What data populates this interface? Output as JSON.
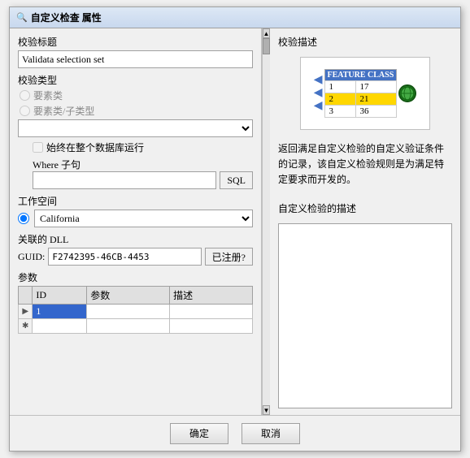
{
  "dialog": {
    "title": "自定义检查 属性"
  },
  "left": {
    "section_validation_title": "校验标题",
    "validation_title_value": "Validata selection set",
    "section_type": "校验类型",
    "type_option1": "要素类",
    "type_option2": "要素类/子类型",
    "checkbox_label": "始终在整个数据库运行",
    "where_label": "Where 子句",
    "where_placeholder": "",
    "sql_button": "SQL",
    "section_workspace": "工作空间",
    "workspace_value": "California",
    "section_dll": "关联的 DLL",
    "guid_label": "GUID:",
    "guid_value": "F2742395-46CB-4453",
    "reg_button": "已注册?",
    "section_params": "参数",
    "table_headers": [
      "ID",
      "参数",
      "描述"
    ],
    "table_rows": [
      {
        "indicator": "▶",
        "id": "1",
        "param": "",
        "desc": "",
        "active": true
      },
      {
        "indicator": "✱",
        "id": "",
        "param": "",
        "desc": "",
        "active": false
      }
    ]
  },
  "right": {
    "section_desc": "校验描述",
    "feature_class_label": "FEATURE CLASS",
    "fc_data": [
      {
        "row": "1",
        "val": "17",
        "active": false
      },
      {
        "row": "2",
        "val": "21",
        "active": true
      },
      {
        "row": "3",
        "val": "36",
        "active": false
      }
    ],
    "description_text": "返回满足自定义检验的自定义验证条件的记录，该自定义检验规则是为满足特定要求而开发的。",
    "custom_desc_label": "自定义检验的描述"
  },
  "footer": {
    "ok_label": "确定",
    "cancel_label": "取消"
  }
}
